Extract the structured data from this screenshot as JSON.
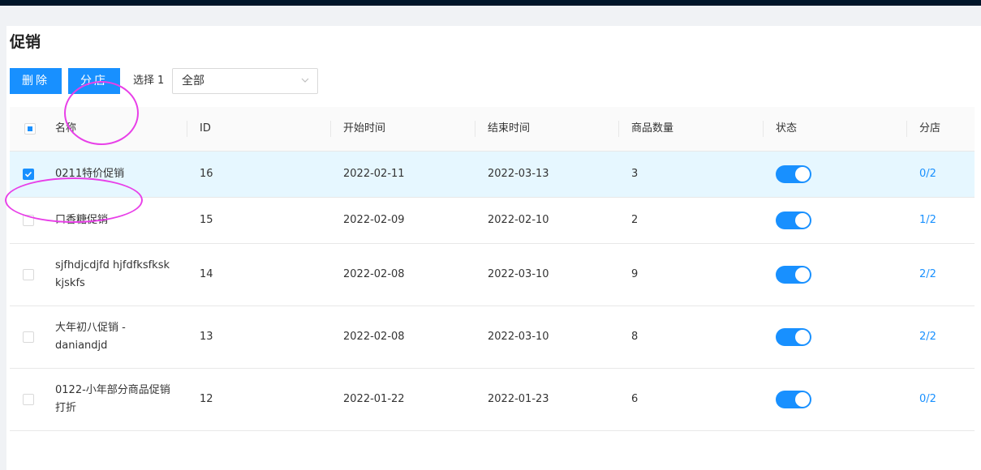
{
  "page": {
    "title": "促销"
  },
  "toolbar": {
    "delete_label": "删除",
    "branch_label": "分店",
    "selected_prefix": "选择",
    "selected_count": "1",
    "filter_value": "全部"
  },
  "table": {
    "columns": [
      "名称",
      "ID",
      "开始时间",
      "结束时间",
      "商品数量",
      "状态",
      "分店"
    ],
    "rows": [
      {
        "name": "0211特价促销",
        "id": "16",
        "start": "2022-02-11",
        "end": "2022-03-13",
        "qty": "3",
        "status": true,
        "branch": "0/2",
        "checked": true
      },
      {
        "name": "口香糖促销",
        "id": "15",
        "start": "2022-02-09",
        "end": "2022-02-10",
        "qty": "2",
        "status": true,
        "branch": "1/2",
        "checked": false
      },
      {
        "name": "sjfhdjcdjfd hjfdfksfksk kjskfs",
        "id": "14",
        "start": "2022-02-08",
        "end": "2022-03-10",
        "qty": "9",
        "status": true,
        "branch": "2/2",
        "checked": false
      },
      {
        "name": "大年初八促销 -daniandjd",
        "id": "13",
        "start": "2022-02-08",
        "end": "2022-03-10",
        "qty": "8",
        "status": true,
        "branch": "2/2",
        "checked": false
      },
      {
        "name": "0122-小年部分商品促销打折",
        "id": "12",
        "start": "2022-01-22",
        "end": "2022-01-23",
        "qty": "6",
        "status": true,
        "branch": "0/2",
        "checked": false
      }
    ]
  },
  "colors": {
    "primary": "#1890ff",
    "annotation": "#e83fe8",
    "selected_row": "#e6f7ff"
  }
}
